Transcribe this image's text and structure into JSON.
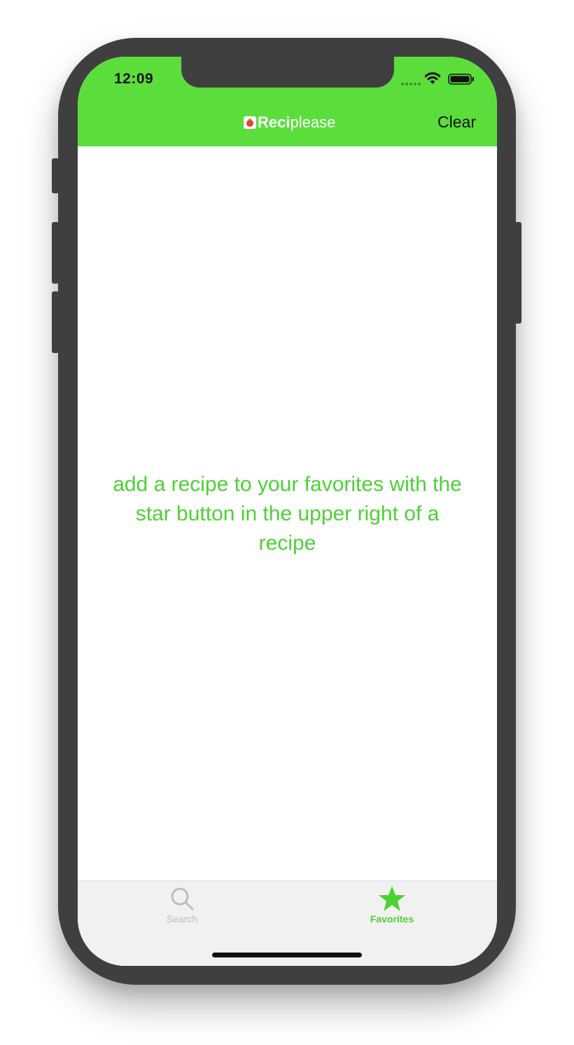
{
  "status_bar": {
    "time": "12:09"
  },
  "nav": {
    "logo_bold": "Reci",
    "logo_light": "please",
    "clear_label": "Clear"
  },
  "empty_state": {
    "message": "add a recipe to your favorites with the star button in the upper right of a recipe"
  },
  "tabs": [
    {
      "label": "Search",
      "icon": "magnifier-icon",
      "selected": false
    },
    {
      "label": "Favorites",
      "icon": "star-icon",
      "selected": true
    }
  ],
  "colors": {
    "accent": "#5bde3c",
    "accent_text": "#4cd134",
    "tab_inactive": "#bdbdbd",
    "tabbar_bg": "#f1f1f1"
  }
}
